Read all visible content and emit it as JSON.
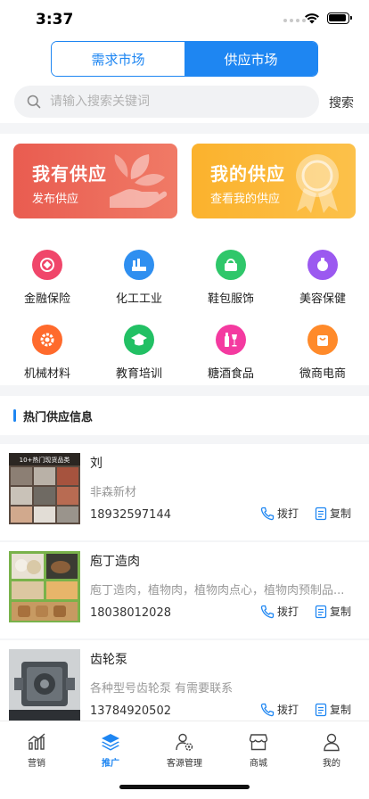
{
  "status": {
    "time": "3:37"
  },
  "header": {
    "tabs": [
      {
        "label": "需求市场",
        "active": false
      },
      {
        "label": "供应市场",
        "active": true
      }
    ],
    "search": {
      "placeholder": "请输入搜索关键词",
      "button": "搜索"
    }
  },
  "cards": [
    {
      "title": "我有供应",
      "subtitle": "发布供应",
      "color": "#ec6357",
      "icon": "leaf-hand-icon"
    },
    {
      "title": "我的供应",
      "subtitle": "查看我的供应",
      "color": "#fbb42f",
      "icon": "award-ribbon-icon"
    }
  ],
  "categories": [
    {
      "label": "金融保险",
      "color": "#f0466a",
      "icon": "coin-icon"
    },
    {
      "label": "化工工业",
      "color": "#2f8ff0",
      "icon": "factory-icon"
    },
    {
      "label": "鞋包服饰",
      "color": "#2fc76a",
      "icon": "handbag-icon"
    },
    {
      "label": "美容保健",
      "color": "#9b59f0",
      "icon": "cosmetics-icon"
    },
    {
      "label": "机械材料",
      "color": "#ff6a2c",
      "icon": "gear-icon"
    },
    {
      "label": "教育培训",
      "color": "#22c064",
      "icon": "graduation-cap-icon"
    },
    {
      "label": "糖酒食品",
      "color": "#f43aa0",
      "icon": "wine-icon"
    },
    {
      "label": "微商电商",
      "color": "#ff8a2a",
      "icon": "shopping-bag-icon"
    }
  ],
  "hot": {
    "title": "热门供应信息",
    "call_label": "拨打",
    "copy_label": "复制",
    "items": [
      {
        "title": "刘",
        "description": "非森新材",
        "phone": "18932597144",
        "thumb_caption": "10+热门现货品类"
      },
      {
        "title": "庖丁造肉",
        "description": "庖丁造肉，植物肉，植物肉点心，植物肉预制品...",
        "phone": "18038012028"
      },
      {
        "title": "齿轮泵",
        "description": "各种型号齿轮泵 有需要联系",
        "phone": "13784920502"
      }
    ]
  },
  "tabbar": [
    {
      "label": "营销",
      "icon": "chart-icon",
      "active": false
    },
    {
      "label": "推广",
      "icon": "layers-icon",
      "active": true
    },
    {
      "label": "客源管理",
      "icon": "user-gear-icon",
      "active": false
    },
    {
      "label": "商城",
      "icon": "store-icon",
      "active": false
    },
    {
      "label": "我的",
      "icon": "person-icon",
      "active": false
    }
  ],
  "colors": {
    "accent": "#1e86f2"
  }
}
